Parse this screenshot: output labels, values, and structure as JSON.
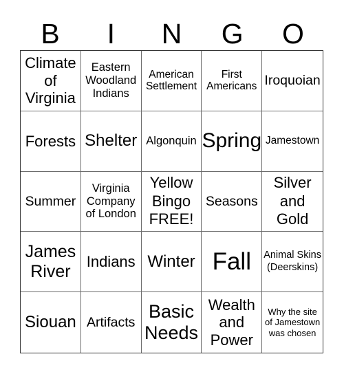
{
  "header": {
    "letters": [
      "B",
      "I",
      "N",
      "G",
      "O"
    ]
  },
  "cells": [
    "Climate of Virginia",
    "Eastern Woodland Indians",
    "American Settlement",
    "First Americans",
    "Iroquoian",
    "Forests",
    "Shelter",
    "Algonquin",
    "Spring",
    "Jamestown",
    "Summer",
    "Virginia Company of London",
    "Yellow Bingo FREE!",
    "Seasons",
    "Silver and Gold",
    "James River",
    "Indians",
    "Winter",
    "Fall",
    "Animal Skins (Deerskins)",
    "Siouan",
    "Artifacts",
    "Basic Needs",
    "Wealth and Power",
    "Why the site of Jamestown was chosen"
  ],
  "free_space": {
    "index": 12,
    "label": "Yellow Bingo FREE!"
  }
}
